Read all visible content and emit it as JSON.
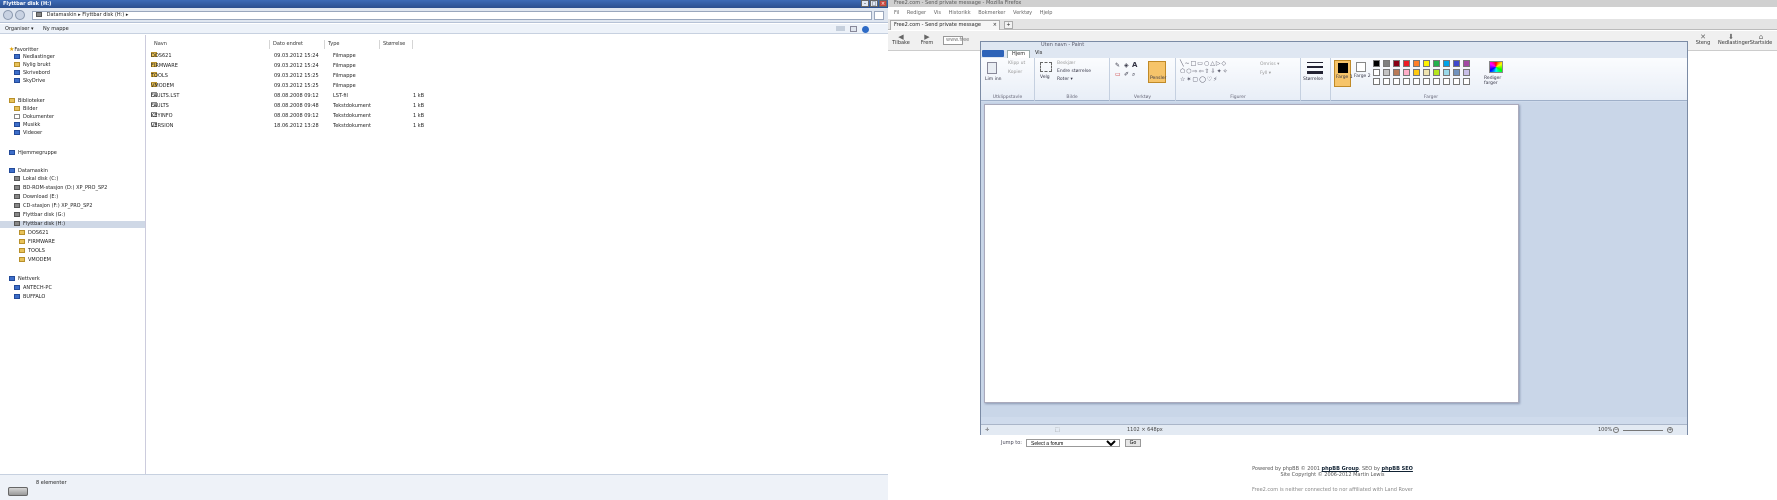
{
  "explorer": {
    "title": "Flyttbar disk (H:)",
    "breadcrumb": "Datamaskin ▸ Flyttbar disk (H:) ▸",
    "toolbar": {
      "organize": "Organiser ▾",
      "new_folder": "Ny mappe"
    },
    "nav": {
      "favorites_header": "Favoritter",
      "favorites": [
        "Nedlastinger",
        "Nylig brukt",
        "Skrivebord",
        "SkyDrive"
      ],
      "libraries_header": "Biblioteker",
      "libraries": [
        "Bilder",
        "Dokumenter",
        "Musikk",
        "Videoer"
      ],
      "homegroup": "Hjemmegruppe",
      "computer_header": "Datamaskin",
      "drives": [
        "Lokal disk (C:)",
        "BD-ROM-stasjon (D:) XP_PRO_SP2",
        "Download (E:)",
        "CD-stasjon (F:) XP_PRO_SP2",
        "Flyttbar disk (G:)",
        "Flyttbar disk (H:)"
      ],
      "subfolders": [
        "DOS621",
        "FIRMWARE",
        "TOOLS",
        "VMODEM"
      ],
      "network_header": "Nettverk",
      "network": [
        "ANTECH-PC",
        "BUFFALO"
      ]
    },
    "columns": [
      "Navn",
      "Dato endret",
      "Type",
      "Størrelse"
    ],
    "files": [
      {
        "name": "DOS621",
        "date": "09.03.2012 15:24",
        "type": "Filmappe",
        "size": "",
        "kind": "folder"
      },
      {
        "name": "FIRMWARE",
        "date": "09.03.2012 15:24",
        "type": "Filmappe",
        "size": "",
        "kind": "folder"
      },
      {
        "name": "TOOLS",
        "date": "09.03.2012 15:25",
        "type": "Filmappe",
        "size": "",
        "kind": "folder"
      },
      {
        "name": "VMODEM",
        "date": "09.03.2012 15:25",
        "type": "Filmappe",
        "size": "",
        "kind": "folder"
      },
      {
        "name": "FAULTS.LST",
        "date": "08.08.2008 09:12",
        "type": "LST-fil",
        "size": "1 kB",
        "kind": "file"
      },
      {
        "name": "FAULTS",
        "date": "08.08.2008 09:48",
        "type": "Tekstdokument",
        "size": "1 kB",
        "kind": "file"
      },
      {
        "name": "KEYINFO",
        "date": "08.08.2008 09:12",
        "type": "Tekstdokument",
        "size": "1 kB",
        "kind": "file"
      },
      {
        "name": "VERSION",
        "date": "18.06.2012 13:28",
        "type": "Tekstdokument",
        "size": "1 kB",
        "kind": "file"
      }
    ],
    "status": "8 elementer"
  },
  "firefox": {
    "title": "Free2.com - Send private message - Mozilla Firefox",
    "menu": [
      "Fil",
      "Rediger",
      "Vis",
      "Historikk",
      "Bokmerker",
      "Verktøy",
      "Hjelp"
    ],
    "tab": "Free2.com - Send private message",
    "nav": {
      "back": "Tilbake",
      "forward": "Frem",
      "url": "www.free",
      "downloads": "Nedlastinger",
      "home": "Startside",
      "close": "Steng"
    },
    "jump_label": "Jump to:",
    "jump_selected": "Select a forum",
    "go_label": "Go",
    "footer_powered": "Powered by phpBB © 2001",
    "footer_phpbb_group": "phpBB Group",
    "footer_seo_by": ". SEO by",
    "footer_phpbb_seo": "phpBB SEO",
    "footer_copyright": "Site Copyright © 2006-2012 Martin Lewis",
    "footer_disclaimer": "Free2.com is neither connected to nor affiliated with Land Rover"
  },
  "paint": {
    "title": "Uten navn - Paint",
    "tabs": [
      "Hjem",
      "Vis"
    ],
    "groups": [
      "Utklippstavle",
      "Bilde",
      "Verktøy",
      "Figurer",
      "Farger"
    ],
    "clipboard": {
      "paste": "Lim inn",
      "cut": "Klipp ut",
      "copy": "Kopier"
    },
    "image": {
      "select": "Velg",
      "crop": "Beskjær",
      "resize": "Endre størrelse",
      "rotate": "Roter ▾"
    },
    "brushes": "Pensler",
    "shapes": {
      "outline": "Omriss ▾",
      "fill": "Fyll ▾"
    },
    "size": "Størrelse",
    "color1": "Farge 1",
    "color2": "Farge 2",
    "edit_colors": "Rediger farger",
    "palette": [
      "#000000",
      "#7f7f7f",
      "#880015",
      "#ed1c24",
      "#ff7f27",
      "#fff200",
      "#22b14c",
      "#00a2e8",
      "#3f48cc",
      "#a349a4",
      "#ffffff",
      "#c3c3c3",
      "#b97a57",
      "#ffaec9",
      "#ffc90e",
      "#efe4b0",
      "#b5e61d",
      "#99d9ea",
      "#7092be",
      "#c8bfe7"
    ],
    "status_size": "1102 × 648px",
    "zoom": "100%"
  }
}
